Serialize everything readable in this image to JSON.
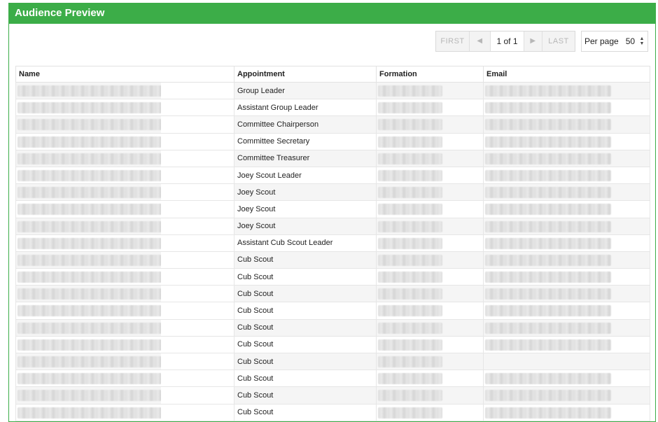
{
  "panel": {
    "title": "Audience Preview"
  },
  "pager": {
    "first": "FIRST",
    "prev_icon": "left-triangle-icon",
    "info": "1 of 1",
    "next_icon": "right-triangle-icon",
    "last": "LAST"
  },
  "per_page": {
    "label": "Per page",
    "value": "50"
  },
  "table": {
    "columns": [
      "Name",
      "Appointment",
      "Formation",
      "Email"
    ],
    "rows": [
      {
        "appointment": "Group Leader",
        "email_visible": true
      },
      {
        "appointment": "Assistant Group Leader",
        "email_visible": true
      },
      {
        "appointment": "Committee Chairperson",
        "email_visible": true
      },
      {
        "appointment": "Committee Secretary",
        "email_visible": true
      },
      {
        "appointment": "Committee Treasurer",
        "email_visible": true
      },
      {
        "appointment": "Joey Scout Leader",
        "email_visible": true
      },
      {
        "appointment": "Joey Scout",
        "email_visible": true
      },
      {
        "appointment": "Joey Scout",
        "email_visible": true
      },
      {
        "appointment": "Joey Scout",
        "email_visible": true
      },
      {
        "appointment": "Assistant Cub Scout Leader",
        "email_visible": true
      },
      {
        "appointment": "Cub Scout",
        "email_visible": true
      },
      {
        "appointment": "Cub Scout",
        "email_visible": true
      },
      {
        "appointment": "Cub Scout",
        "email_visible": true
      },
      {
        "appointment": "Cub Scout",
        "email_visible": true
      },
      {
        "appointment": "Cub Scout",
        "email_visible": true
      },
      {
        "appointment": "Cub Scout",
        "email_visible": true
      },
      {
        "appointment": "Cub Scout",
        "email_visible": false
      },
      {
        "appointment": "Cub Scout",
        "email_visible": true
      },
      {
        "appointment": "Cub Scout",
        "email_visible": true
      },
      {
        "appointment": "Cub Scout",
        "email_visible": true
      }
    ]
  },
  "colors": {
    "header_green": "#3cad48"
  }
}
